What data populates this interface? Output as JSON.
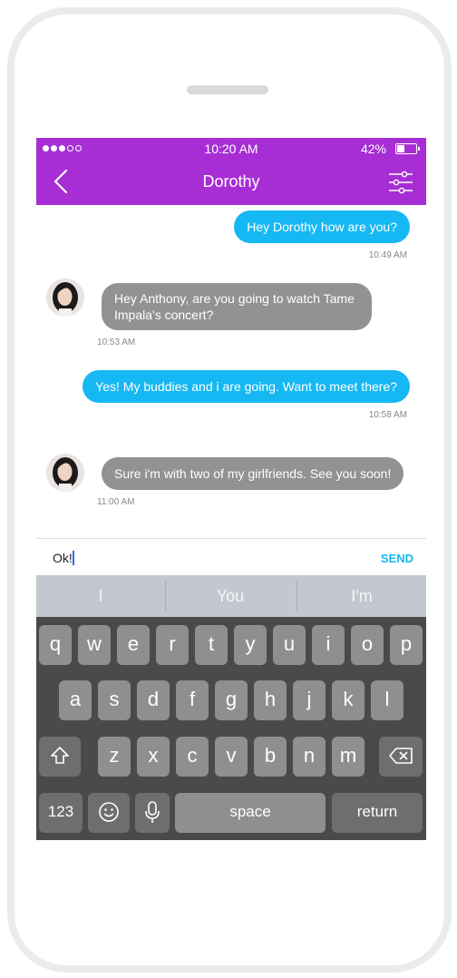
{
  "status": {
    "time": "10:20 AM",
    "battery": "42%",
    "battery_level": 0.42
  },
  "header": {
    "title": "Dorothy"
  },
  "messages": [
    {
      "text": "Hey Dorothy how are you?",
      "time": "10:49 AM",
      "side": "out"
    },
    {
      "text": "Hey Anthony, are you going to watch Tame Impala's concert?",
      "time": "10:53 AM",
      "side": "in"
    },
    {
      "text": "Yes! My buddies and i are going. Want to meet there?",
      "time": "10:58 AM",
      "side": "out"
    },
    {
      "text": "Sure i'm with two of my girlfriends. See you soon!",
      "time": "11:00 AM",
      "side": "in"
    }
  ],
  "compose": {
    "value": "Ok!",
    "send_label": "SEND"
  },
  "suggestions": [
    "I",
    "You",
    "I'm"
  ],
  "keyboard": {
    "row1": [
      "q",
      "w",
      "e",
      "r",
      "t",
      "y",
      "u",
      "i",
      "o",
      "p"
    ],
    "row2": [
      "a",
      "s",
      "d",
      "f",
      "g",
      "h",
      "j",
      "k",
      "l"
    ],
    "row3": [
      "z",
      "x",
      "c",
      "v",
      "b",
      "n",
      "m"
    ],
    "numbers_label": "123",
    "space_label": "space",
    "return_label": "return"
  },
  "colors": {
    "header": "#a62ed4",
    "outgoing": "#16b8f3",
    "incoming": "#929292",
    "send": "#16b8f3"
  }
}
